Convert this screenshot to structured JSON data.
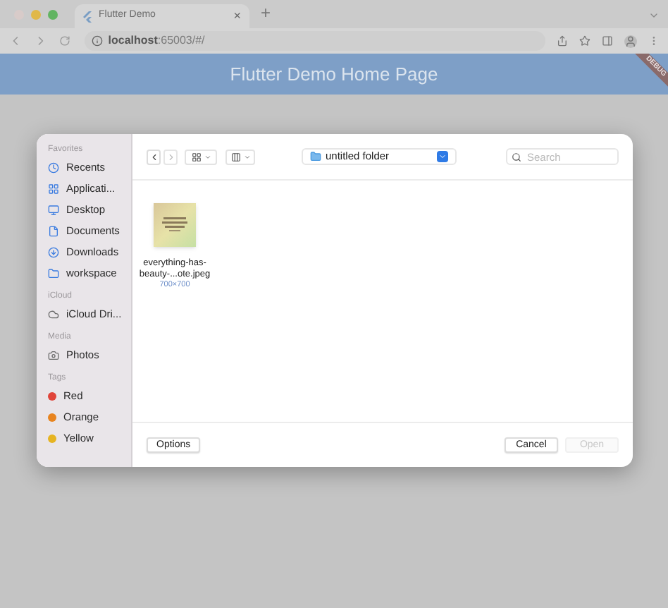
{
  "browser": {
    "tab": {
      "title": "Flutter Demo",
      "close": "×"
    },
    "new_tab": "+",
    "url": {
      "host": "localhost",
      "rest": ":65003/#/"
    }
  },
  "app_bar": {
    "title": "Flutter Demo Home Page",
    "banner": "DEBUG"
  },
  "dialog": {
    "sidebar": [
      {
        "heading": "Favorites",
        "items": [
          {
            "label": "Recents",
            "kind": "place"
          },
          {
            "label": "Applicati...",
            "kind": "place"
          },
          {
            "label": "Desktop",
            "kind": "place"
          },
          {
            "label": "Documents",
            "kind": "place"
          },
          {
            "label": "Downloads",
            "kind": "place"
          },
          {
            "label": "workspace",
            "kind": "place"
          }
        ]
      },
      {
        "heading": "iCloud",
        "items": [
          {
            "label": "iCloud Dri...",
            "kind": "place"
          }
        ]
      },
      {
        "heading": "Media",
        "items": [
          {
            "label": "Photos",
            "kind": "place"
          }
        ]
      },
      {
        "heading": "Tags",
        "items": [
          {
            "label": "Red",
            "kind": "tag",
            "color": "#e0443a"
          },
          {
            "label": "Orange",
            "kind": "tag",
            "color": "#e8841f"
          },
          {
            "label": "Yellow",
            "kind": "tag",
            "color": "#e6b422"
          }
        ]
      }
    ],
    "location": "untitled folder",
    "search": {
      "placeholder": "Search"
    },
    "files": [
      {
        "name_lines": [
          "everything-has-",
          "beauty-...ote.jpeg"
        ],
        "size": "700×700"
      }
    ],
    "buttons": [
      {
        "label": "Options",
        "disabled": false
      },
      {
        "label": "Cancel",
        "disabled": false
      },
      {
        "label": "Open",
        "disabled": true
      }
    ]
  }
}
